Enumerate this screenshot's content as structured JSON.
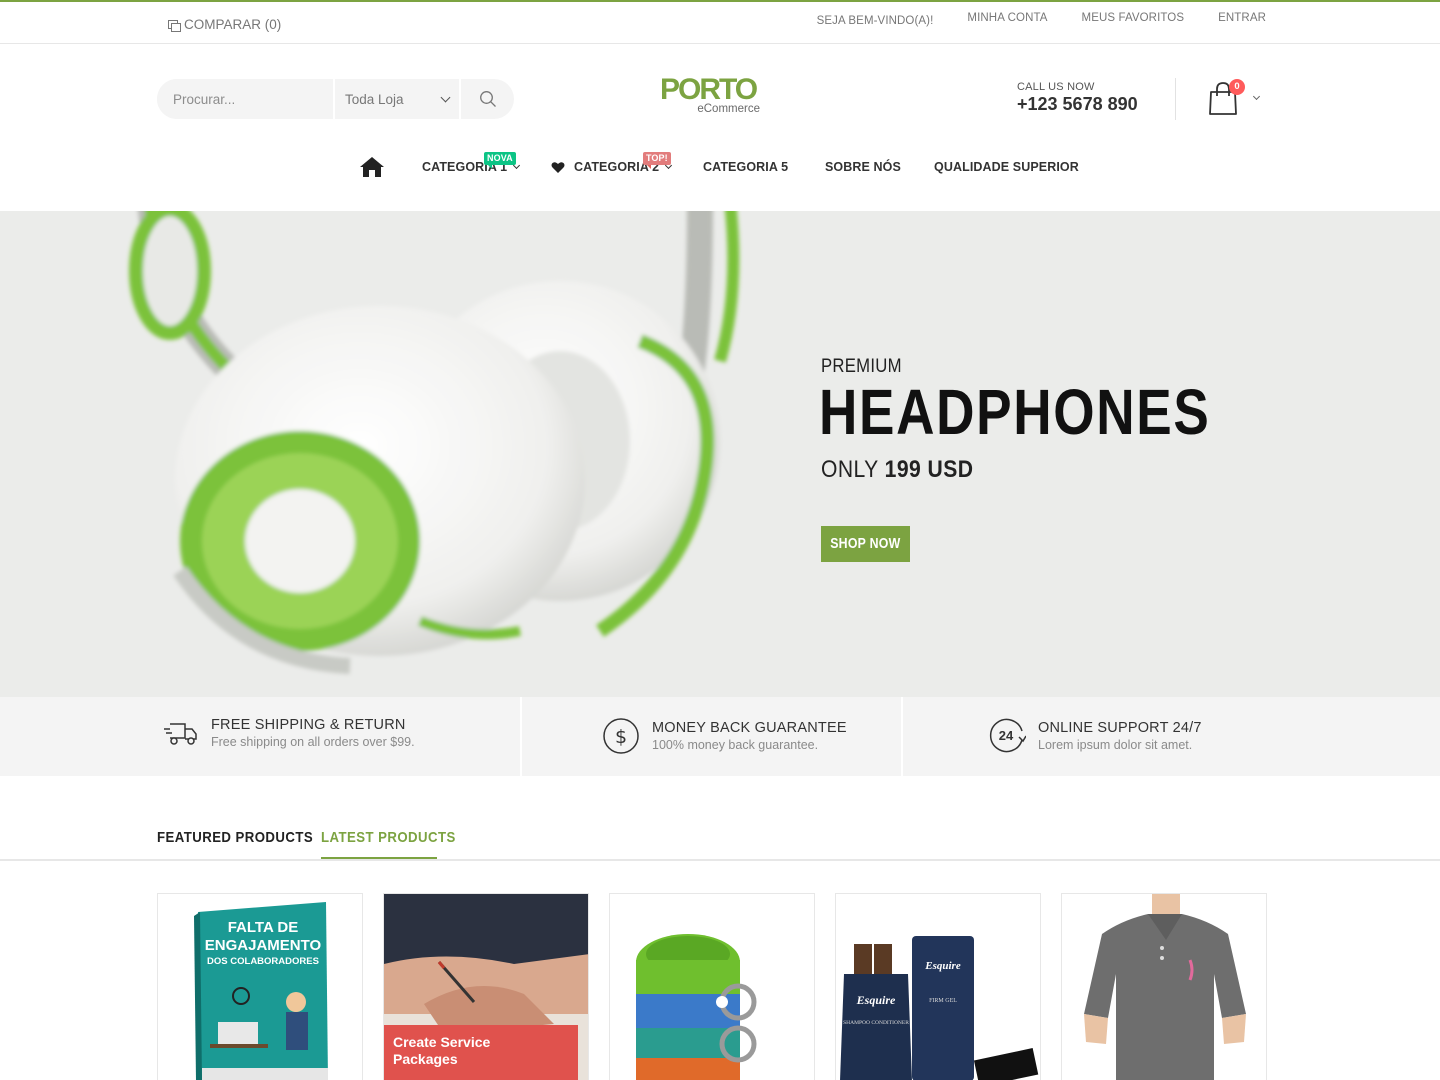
{
  "topbar": {
    "compare_label": "COMPARAR (0)",
    "welcome": "SEJA BEM-VINDO(A)!",
    "my_account": "MINHA CONTA",
    "wishlist": "MEUS FAVORITOS",
    "login": "ENTRAR"
  },
  "header": {
    "search": {
      "placeholder": "Procurar...",
      "category": "Toda Loja"
    },
    "logo": {
      "main": "PORTO",
      "sub": "eCommerce"
    },
    "call": {
      "label": "CALL US NOW",
      "number": "+123 5678 890"
    },
    "cart": {
      "count": "0"
    }
  },
  "nav": {
    "items": [
      {
        "label": "CATEGORIA 1",
        "tip": "NOVA"
      },
      {
        "label": "CATEGORIA 2",
        "tip": "TOP!"
      },
      {
        "label": "CATEGORIA 5"
      },
      {
        "label": "SOBRE NÓS"
      },
      {
        "label": "QUALIDADE SUPERIOR"
      }
    ]
  },
  "hero": {
    "subtitle": "PREMIUM",
    "title": "HEADPHONES",
    "price_prefix": "ONLY",
    "price": "199 USD",
    "button": "SHOP NOW"
  },
  "info": [
    {
      "title": "FREE SHIPPING & RETURN",
      "desc": "Free shipping on all orders over $99."
    },
    {
      "title": "MONEY BACK GUARANTEE",
      "desc": "100% money back guarantee."
    },
    {
      "title": "ONLINE SUPPORT 24/7",
      "desc": "Lorem ipsum dolor sit amet."
    }
  ],
  "products": {
    "tabs": [
      "FEATURED PRODUCTS",
      "LATEST PRODUCTS"
    ],
    "active_tab": "LATEST PRODUCTS",
    "book_lines": [
      "FALTA DE",
      "ENGAJAMENTO",
      "DOS COLABORADORES"
    ],
    "service_banner": [
      "Create Service",
      "Packages"
    ],
    "bottle_brand": "Esquire",
    "bottle_label": "SHAMPOO CONDITIONER",
    "tube_label": "FIRM GEL"
  },
  "icons": {
    "search": "search-icon",
    "cart": "shopping-bag-icon",
    "home": "home-icon",
    "heart": "heart-icon",
    "truck": "truck-icon",
    "dollar": "dollar-circle-icon",
    "support": "24-hours-icon"
  },
  "colors": {
    "brand": "#7ca341",
    "badge_red": "#ff5b5b",
    "tip_new": "#0cc485",
    "tip_top": "#e36159",
    "hero_bg": "#ebecea"
  }
}
